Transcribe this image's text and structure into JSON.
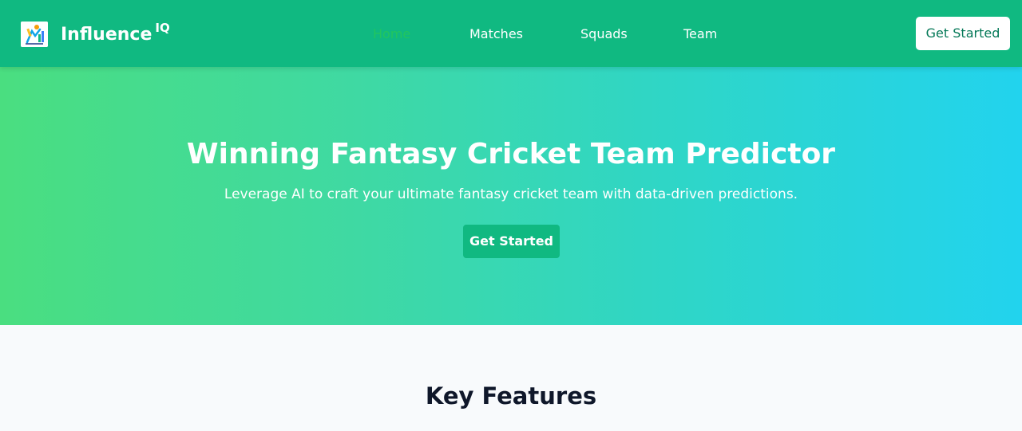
{
  "navbar": {
    "brand": "Influence",
    "brand_sup": "IQ",
    "links": [
      {
        "label": "Home",
        "active": true
      },
      {
        "label": "Matches",
        "active": false
      },
      {
        "label": "Squads",
        "active": false
      },
      {
        "label": "Team",
        "active": false
      }
    ],
    "cta_label": "Get Started",
    "logo_icon": "cricket-logo-icon"
  },
  "hero": {
    "title": "Winning Fantasy Cricket Team Predictor",
    "subtitle": "Leverage AI to craft your ultimate fantasy cricket team with data-driven predictions.",
    "cta_label": "Get Started"
  },
  "features": {
    "title": "Key Features"
  },
  "colors": {
    "primary": "#10b981",
    "active_link": "#22c55e",
    "gradient_start": "#4ade80",
    "gradient_end": "#22d3ee",
    "heading_dark": "#0f172a"
  }
}
